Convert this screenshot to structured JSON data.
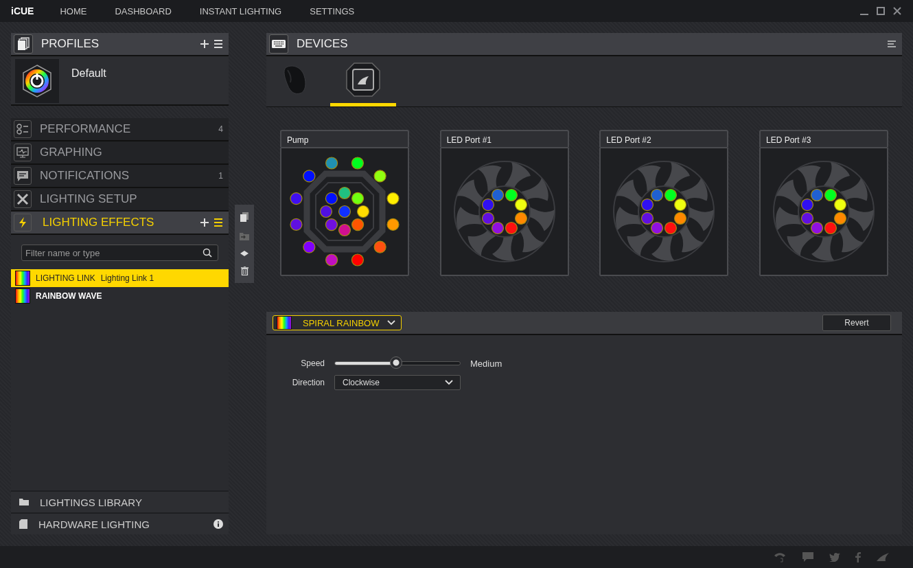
{
  "app": {
    "logo": "iCUE"
  },
  "nav": [
    {
      "label": "HOME"
    },
    {
      "label": "DASHBOARD"
    },
    {
      "label": "INSTANT LIGHTING"
    },
    {
      "label": "SETTINGS"
    }
  ],
  "profiles": {
    "title": "PROFILES",
    "profile": "Default"
  },
  "sections": [
    {
      "kind": "performance",
      "label": "PERFORMANCE",
      "count": "4",
      "selected": false
    },
    {
      "kind": "graphing",
      "label": "GRAPHING",
      "selected": false
    },
    {
      "kind": "notifications",
      "label": "NOTIFICATIONS",
      "count": "1",
      "selected": false
    },
    {
      "kind": "setup",
      "label": "LIGHTING SETUP",
      "selected": false
    },
    {
      "kind": "effects",
      "label": "LIGHTING EFFECTS",
      "selected": true
    }
  ],
  "filter": {
    "placeholder": "Filter name or type"
  },
  "effects": [
    {
      "name": "LIGHTING LINK",
      "detail": "Lighting Link 1",
      "selected": true
    },
    {
      "name": "RAINBOW WAVE",
      "selected": false
    }
  ],
  "library": [
    {
      "kind": "library",
      "label": "LIGHTINGS LIBRARY"
    },
    {
      "kind": "hardware",
      "label": "HARDWARE LIGHTING"
    }
  ],
  "devices": {
    "title": "DEVICES",
    "tabs": [
      {
        "kind": "mouse",
        "selected": false
      },
      {
        "kind": "cooler",
        "selected": true
      }
    ]
  },
  "zones": [
    {
      "name": "Pump",
      "kind": "pump",
      "outer_leds": [
        {
          "color": "#2090b0"
        },
        {
          "color": "#00ff20"
        },
        {
          "color": "#90ff10"
        },
        {
          "color": "#ffee00"
        },
        {
          "color": "#ff9900"
        },
        {
          "color": "#ff5010"
        },
        {
          "color": "#ff0000"
        },
        {
          "color": "#c010c0"
        },
        {
          "color": "#8000ff"
        },
        {
          "color": "#6010e0"
        },
        {
          "color": "#4010f0"
        },
        {
          "color": "#0010ff"
        }
      ],
      "inner_leds": [
        {
          "color": "#20c080"
        },
        {
          "color": "#70ff10"
        },
        {
          "color": "#ffdd00"
        },
        {
          "color": "#ff5500"
        },
        {
          "color": "#d01090"
        },
        {
          "color": "#7010e0"
        },
        {
          "color": "#5010e0"
        },
        {
          "color": "#0010ff"
        }
      ],
      "center_led": {
        "color": "#1030ff"
      }
    },
    {
      "name": "LED Port #1",
      "kind": "fan",
      "leds": [
        {
          "color": "#2060d0"
        },
        {
          "color": "#00ff20"
        },
        {
          "color": "#eeff10"
        },
        {
          "color": "#ff8800"
        },
        {
          "color": "#ff1010"
        },
        {
          "color": "#9010e0"
        },
        {
          "color": "#6010e0"
        },
        {
          "color": "#3010f0"
        }
      ]
    },
    {
      "name": "LED Port #2",
      "kind": "fan",
      "leds": [
        {
          "color": "#2060d0"
        },
        {
          "color": "#00ff20"
        },
        {
          "color": "#eeff10"
        },
        {
          "color": "#ff8800"
        },
        {
          "color": "#ff1010"
        },
        {
          "color": "#9010e0"
        },
        {
          "color": "#6010e0"
        },
        {
          "color": "#3010f0"
        }
      ]
    },
    {
      "name": "LED Port #3",
      "kind": "fan",
      "leds": [
        {
          "color": "#2060d0"
        },
        {
          "color": "#00ff20"
        },
        {
          "color": "#eeff10"
        },
        {
          "color": "#ff8800"
        },
        {
          "color": "#ff1010"
        },
        {
          "color": "#9010e0"
        },
        {
          "color": "#6010e0"
        },
        {
          "color": "#3010f0"
        }
      ]
    }
  ],
  "effect": {
    "name": "SPIRAL RAINBOW",
    "revert": "Revert",
    "speed": {
      "label": "Speed",
      "level": 0.49,
      "reading": "Medium"
    },
    "direction": {
      "label": "Direction",
      "value": "Clockwise"
    }
  }
}
